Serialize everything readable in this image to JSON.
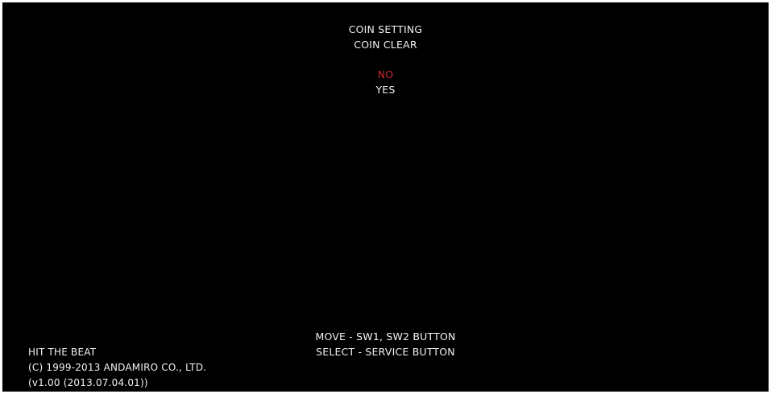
{
  "menu": {
    "title_lines": [
      "COIN SETTING",
      "COIN CLEAR"
    ],
    "options": [
      {
        "label": "NO",
        "selected": true
      },
      {
        "label": "YES",
        "selected": false
      }
    ]
  },
  "controls": {
    "move": "MOVE - SW1, SW2 BUTTON",
    "select": "SELECT - SERVICE BUTTON"
  },
  "credits": {
    "game_title": "HIT THE BEAT",
    "copyright": "(C) 1999-2013 ANDAMIRO CO., LTD.",
    "version": "(v1.00 (2013.07.04.01))"
  },
  "colors": {
    "background": "#000000",
    "text": "#f2f2f2",
    "selected": "#c8282d"
  }
}
